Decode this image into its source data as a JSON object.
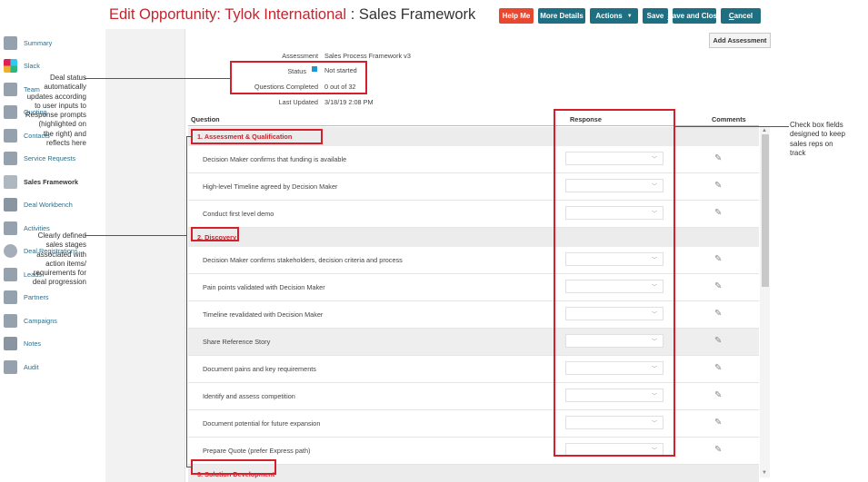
{
  "header": {
    "title_prefix": "Edit Opportunity: ",
    "title_account": "Tylok International",
    "title_sep": " : ",
    "title_page": "Sales Framework",
    "buttons": {
      "help_me": "Help Me",
      "more_details": "More Details",
      "actions": "Actions",
      "actions_caret": "▼",
      "save": "Save",
      "save_and_close_u": "S",
      "save_and_close_rest": "ave and Close",
      "cancel_u": "C",
      "cancel_rest": "ancel"
    }
  },
  "sidebar": {
    "items": [
      {
        "label": "Summary",
        "icon": "summary-icon"
      },
      {
        "label": "Slack",
        "icon": "slack-icon"
      },
      {
        "label": "Team",
        "icon": "team-icon"
      },
      {
        "label": "Quoting",
        "icon": "quoting-icon"
      },
      {
        "label": "Contacts",
        "icon": "contacts-icon"
      },
      {
        "label": "Service Requests",
        "icon": "service-requests-icon"
      },
      {
        "label": "Sales Framework",
        "icon": "sales-framework-icon",
        "active": true
      },
      {
        "label": "Deal Workbench",
        "icon": "camera-icon"
      },
      {
        "label": "Activities",
        "icon": "activities-icon"
      },
      {
        "label": "Deal Registrations",
        "icon": "check-circle-icon"
      },
      {
        "label": "Leads",
        "icon": "leads-icon"
      },
      {
        "label": "Partners",
        "icon": "handshake-icon"
      },
      {
        "label": "Campaigns",
        "icon": "campaigns-icon"
      },
      {
        "label": "Notes",
        "icon": "notes-icon"
      },
      {
        "label": "Audit",
        "icon": "audit-icon"
      }
    ]
  },
  "assessment": {
    "add_button": "Add Assessment",
    "assessment_label": "Assessment",
    "assessment_value": "Sales Process Framework v3",
    "status_label": "Status",
    "status_value": "Not started",
    "status_color": "#2196d4",
    "questions_label": "Questions Completed",
    "questions_value": "0 out of 32",
    "updated_label": "Last Updated",
    "updated_value": "3/18/19 2:08 PM"
  },
  "table": {
    "col_question": "Question",
    "col_response": "Response",
    "col_comments": "Comments",
    "sections": [
      {
        "title": "1. Assessment & Qualification",
        "questions": [
          "Decision Maker confirms that funding is available",
          "High-level Timeline agreed by Decision Maker",
          "Conduct first level demo"
        ]
      },
      {
        "title": "2. Discovery",
        "questions": [
          "Decision Maker confirms stakeholders, decision criteria and process",
          "Pain points validated with Decision Maker",
          "Timeline revalidated with Decision Maker",
          "Share Reference Story",
          "Document pains and key requirements",
          "Identify and assess competition",
          "Document potential for future expansion",
          "Prepare Quote (prefer Express path)"
        ]
      },
      {
        "title": "3. Solution Development",
        "questions": []
      }
    ]
  },
  "annotations": {
    "deal_status": [
      "Deal status",
      "automatically",
      "updates according",
      "to user inputs to",
      "Response prompts",
      "(highlighted on",
      "the right) and",
      "reflects here"
    ],
    "sales_stages": [
      "Clearly defined",
      "sales stages",
      "associated with",
      "action items/",
      "requirements for",
      "deal progression"
    ],
    "check_box": [
      "Check box fields",
      "designed to keep",
      "sales reps on",
      "track"
    ]
  },
  "colors": {
    "accent_red": "#c6242d",
    "button_red": "#e8482f",
    "button_teal": "#1f6f82",
    "highlight_box": "#d51f2b"
  }
}
